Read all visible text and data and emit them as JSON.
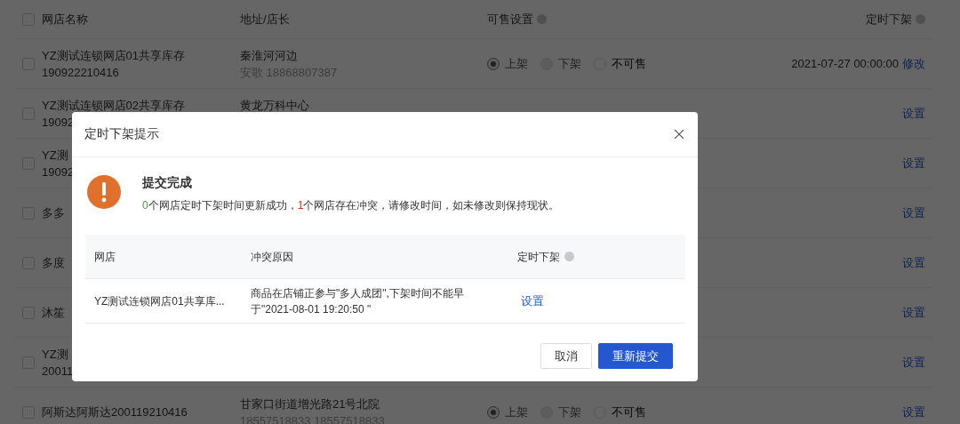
{
  "table": {
    "all_checked": false,
    "columns": [
      {
        "label": "网店名称",
        "help": false
      },
      {
        "label": "地址/店长",
        "help": false
      },
      {
        "label": "可售设置",
        "help": true
      },
      {
        "label": "定时下架",
        "help": true
      }
    ],
    "rows": [
      {
        "checked": false,
        "name": [
          "YZ测试连锁网店01共享库存",
          "190922210416"
        ],
        "address": "秦淮河河边",
        "contact": "安歌 18868807387",
        "radios": [
          {
            "label": "上架",
            "selected": true,
            "disabled": true
          },
          {
            "label": "下架",
            "selected": false,
            "disabled": true
          },
          {
            "label": "不可售",
            "selected": false,
            "disabled": false
          }
        ],
        "time": "2021-07-27 00:00:00",
        "action": "修改"
      },
      {
        "checked": false,
        "name": [
          "YZ测试连锁网店02共享库存",
          "19092"
        ],
        "address": "黄龙万科中心",
        "action": "设置"
      },
      {
        "checked": false,
        "name": [
          "YZ测",
          "19092"
        ],
        "action": "设置"
      },
      {
        "checked": false,
        "name": [
          "多多"
        ],
        "action": "设置"
      },
      {
        "checked": false,
        "name": [
          "多度"
        ],
        "action": "设置"
      },
      {
        "checked": false,
        "name": [
          "沐笙"
        ],
        "action": "设置"
      },
      {
        "checked": false,
        "name": [
          "YZ测",
          "20011"
        ],
        "action": "设置"
      },
      {
        "checked": false,
        "name": [
          "阿斯达阿斯达200119210416"
        ],
        "address": "甘家口街道增光路21号北院",
        "contact": "18557518833 18557518833",
        "radios": [
          {
            "label": "上架",
            "selected": true,
            "disabled": true
          },
          {
            "label": "下架",
            "selected": false,
            "disabled": true
          },
          {
            "label": "不可售",
            "selected": false,
            "disabled": false
          }
        ],
        "action": "设置"
      }
    ]
  },
  "dialog": {
    "title": "定时下架提示",
    "alert": {
      "title": "提交完成",
      "message": [
        {
          "kind": "success",
          "text": "0"
        },
        {
          "kind": "plain",
          "text": "个网店定时下架时间更新成功，"
        },
        {
          "kind": "conflict",
          "text": "1"
        },
        {
          "kind": "plain",
          "text": "个网店存在冲突，请修改时间，如未修改则保持现状。"
        }
      ]
    },
    "conflicts": {
      "columns": [
        {
          "label": "网店",
          "help": false
        },
        {
          "label": "冲突原因",
          "help": false
        },
        {
          "label": "定时下架",
          "help": true
        }
      ],
      "rows": [
        {
          "store": "YZ测试连锁网店01共享库...",
          "reason": "商品在店铺正参与\"多人成团\",下架时间不能早于\"2021-08-01 19:20:50 \"",
          "action": "设置"
        }
      ]
    },
    "buttons": [
      {
        "label": "取消",
        "kind": "secondary"
      },
      {
        "label": "重新提交",
        "kind": "primary"
      }
    ]
  }
}
